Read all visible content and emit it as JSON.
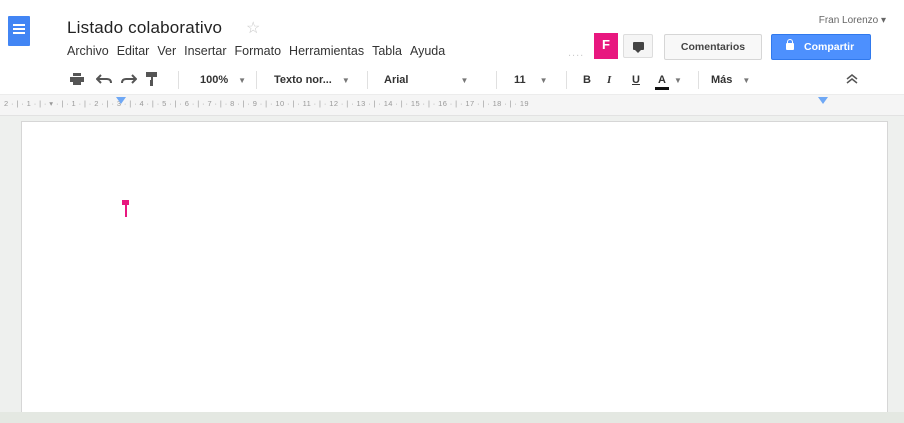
{
  "document": {
    "title": "Listado colaborativo",
    "star_icon": "star-outline-icon"
  },
  "menu": [
    "Archivo",
    "Editar",
    "Ver",
    "Insertar",
    "Formato",
    "Herramientas",
    "Tabla",
    "Ayuda"
  ],
  "header": {
    "user_name": "Fran Lorenzo ▾",
    "collaborator_initial": "F",
    "collaborator_color": "#e8177f",
    "comments_label": "Comentarios",
    "share_label": "Compartir",
    "share_color": "#4d90fe"
  },
  "toolbar": {
    "zoom": "100%",
    "style": "Texto nor...",
    "font": "Arial",
    "size": "11",
    "bold": "B",
    "italic": "I",
    "underline": "U",
    "text_color": "A",
    "more": "Más",
    "collapse": "≈"
  },
  "ruler": {
    "marks": "2 · | · 1 · | · ▾ · | · 1 · | · 2 · | · 3 · | · 4 · | · 5 · | · 6 · | · 7 · | · 8 · | · 9 · | · 10 · | · 11 · | · 12 · | · 13 · | · 14 · | · 15 · | · 16 · | · 17 · | · 18 · | · 19"
  }
}
